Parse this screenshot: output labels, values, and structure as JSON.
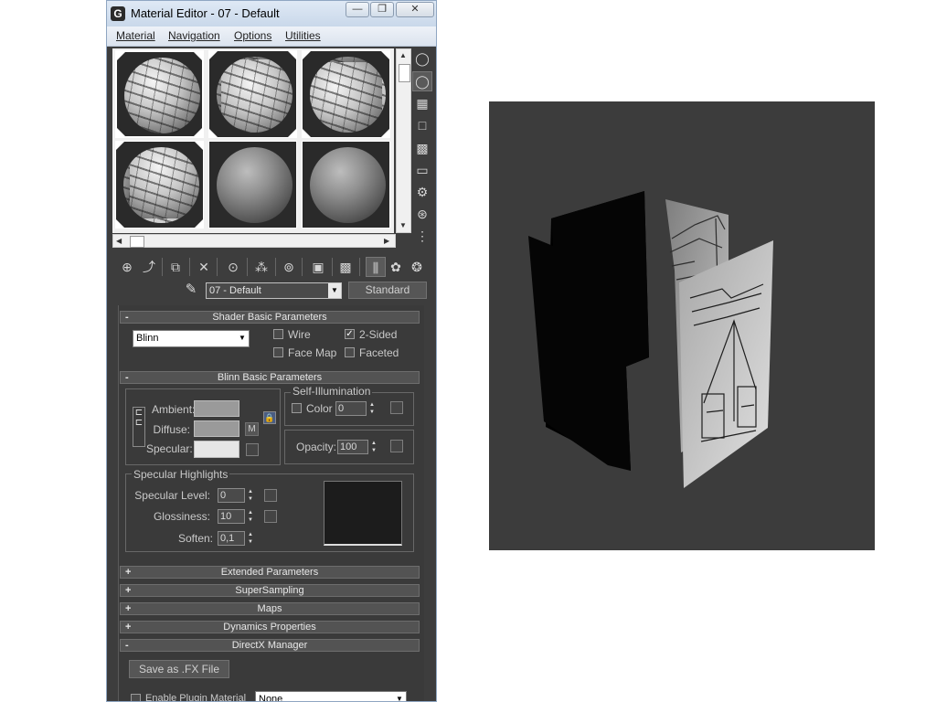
{
  "window": {
    "title": "Material Editor - 07 - Default",
    "app_icon": "G",
    "minimize_glyph": "—",
    "restore_glyph": "❐",
    "close_glyph": "✕"
  },
  "menu": [
    "Material",
    "Navigation",
    "Options",
    "Utilities"
  ],
  "material": {
    "name": "07 - Default",
    "type_button": "Standard"
  },
  "shader_basic": {
    "title": "Shader Basic Parameters",
    "collapse_sign": "-",
    "shader": "Blinn",
    "wire_label": "Wire",
    "wire": false,
    "two_sided_label": "2-Sided",
    "two_sided": true,
    "face_map_label": "Face Map",
    "face_map": false,
    "faceted_label": "Faceted",
    "faceted": false
  },
  "blinn_basic": {
    "title": "Blinn Basic Parameters",
    "collapse_sign": "-",
    "ambient_label": "Ambient:",
    "diffuse_label": "Diffuse:",
    "specular_label": "Specular:",
    "map_button": "M",
    "self_illum_title": "Self-Illumination",
    "color_label": "Color",
    "self_illum_value": "0",
    "opacity_label": "Opacity:",
    "opacity_value": "100",
    "ambient_color": "#9a9a9a",
    "diffuse_color": "#9a9a9a",
    "specular_color": "#e6e6e6"
  },
  "specular_highlights": {
    "title": "Specular Highlights",
    "level_label": "Specular Level:",
    "level_value": "0",
    "glossiness_label": "Glossiness:",
    "glossiness_value": "10",
    "soften_label": "Soften:",
    "soften_value": "0,1"
  },
  "rollouts": [
    {
      "sign": "+",
      "title": "Extended Parameters"
    },
    {
      "sign": "+",
      "title": "SuperSampling"
    },
    {
      "sign": "+",
      "title": "Maps"
    },
    {
      "sign": "+",
      "title": "Dynamics Properties"
    },
    {
      "sign": "-",
      "title": "DirectX Manager"
    }
  ],
  "directx": {
    "save_fx_button": "Save as .FX File",
    "enable_plugin_label": "Enable Plugin Material",
    "plugin_value": "None"
  },
  "icons": {
    "side_tools": [
      "sample-type-icon",
      "backlight-icon",
      "background-icon",
      "uv-tiling-icon",
      "video-color-check-icon",
      "make-preview-icon",
      "options-icon",
      "select-by-material-icon",
      "material-map-navigator-icon"
    ],
    "toolbar": [
      "get-material-icon",
      "put-to-scene-icon",
      "assign-to-selection-icon",
      "reset-map-icon",
      "make-copy-icon",
      "make-unique-icon",
      "put-to-library-icon",
      "material-id-channel-icon",
      "show-map-in-viewport-icon",
      "show-end-result-icon",
      "go-to-parent-icon",
      "go-forward-to-sibling-icon"
    ],
    "pick_material": "eyedropper-icon"
  }
}
